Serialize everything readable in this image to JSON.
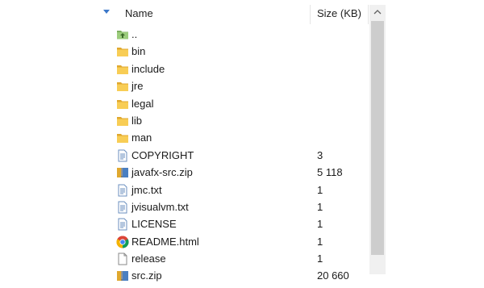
{
  "header": {
    "name_label": "Name",
    "size_label": "Size (KB)"
  },
  "rows": [
    {
      "name": "..",
      "size": "",
      "icon": "parent-folder-icon"
    },
    {
      "name": "bin",
      "size": "",
      "icon": "folder-icon"
    },
    {
      "name": "include",
      "size": "",
      "icon": "folder-icon"
    },
    {
      "name": "jre",
      "size": "",
      "icon": "folder-icon"
    },
    {
      "name": "legal",
      "size": "",
      "icon": "folder-icon"
    },
    {
      "name": "lib",
      "size": "",
      "icon": "folder-icon"
    },
    {
      "name": "man",
      "size": "",
      "icon": "folder-icon"
    },
    {
      "name": "COPYRIGHT",
      "size": "3",
      "icon": "file-icon"
    },
    {
      "name": "javafx-src.zip",
      "size": "5 118",
      "icon": "zip-archive-icon"
    },
    {
      "name": "jmc.txt",
      "size": "1",
      "icon": "text-file-icon"
    },
    {
      "name": "jvisualvm.txt",
      "size": "1",
      "icon": "text-file-icon"
    },
    {
      "name": "LICENSE",
      "size": "1",
      "icon": "file-icon"
    },
    {
      "name": "README.html",
      "size": "1",
      "icon": "chrome-html-icon"
    },
    {
      "name": "release",
      "size": "1",
      "icon": "blank-file-icon"
    },
    {
      "name": "src.zip",
      "size": "20 660",
      "icon": "zip-archive-icon"
    }
  ],
  "colors": {
    "folder": "#f4c542",
    "sort_arrow": "#3c78c9",
    "scroll_thumb": "#cdcdcd",
    "scroll_track": "#f0f0f0"
  }
}
